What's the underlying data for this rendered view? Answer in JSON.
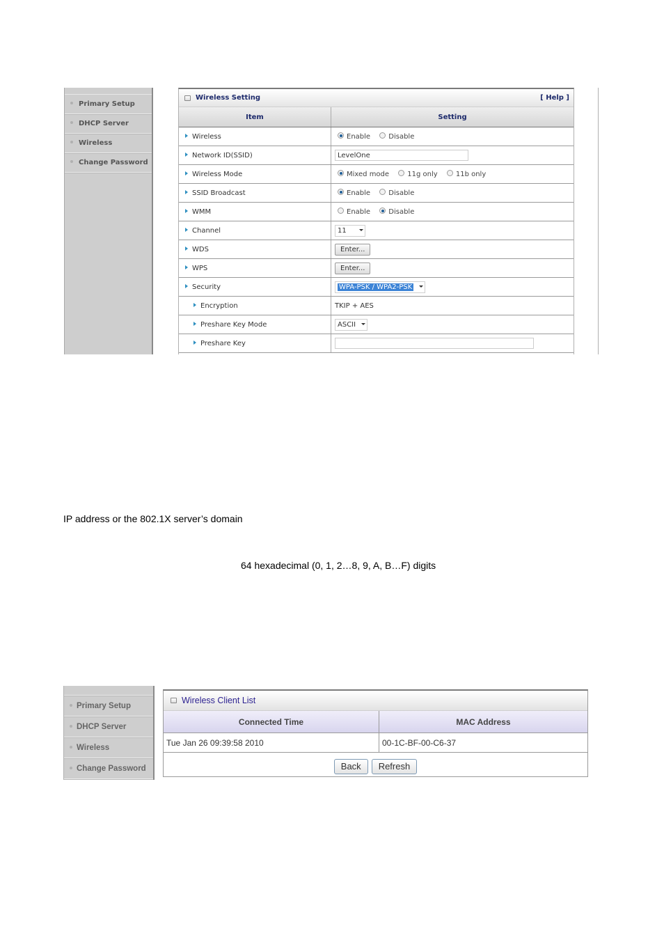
{
  "screenshot1": {
    "sidebar": {
      "items": [
        {
          "label": "Primary Setup"
        },
        {
          "label": "DHCP Server"
        },
        {
          "label": "Wireless"
        },
        {
          "label": "Change Password"
        }
      ]
    },
    "panel": {
      "title": "Wireless Setting",
      "help_link": "[ Help ]",
      "col_item": "Item",
      "col_setting": "Setting",
      "rows": {
        "wireless": {
          "label": "Wireless",
          "opt1": "Enable",
          "opt2": "Disable",
          "selected": "Enable"
        },
        "ssid": {
          "label": "Network ID(SSID)",
          "value": "LevelOne"
        },
        "mode": {
          "label": "Wireless Mode",
          "opt1": "Mixed mode",
          "opt2": "11g only",
          "opt3": "11b only",
          "selected": "Mixed mode"
        },
        "ssid_broadcast": {
          "label": "SSID Broadcast",
          "opt1": "Enable",
          "opt2": "Disable",
          "selected": "Enable"
        },
        "wmm": {
          "label": "WMM",
          "opt1": "Enable",
          "opt2": "Disable",
          "selected": "Disable"
        },
        "channel": {
          "label": "Channel",
          "value": "11"
        },
        "wds": {
          "label": "WDS",
          "button": "Enter..."
        },
        "wps": {
          "label": "WPS",
          "button": "Enter..."
        },
        "security": {
          "label": "Security",
          "value": "WPA-PSK / WPA2-PSK"
        },
        "encryption": {
          "label": "Encryption",
          "value": "TKIP + AES"
        },
        "key_mode": {
          "label": "Preshare Key Mode",
          "value": "ASCII"
        },
        "preshare_key": {
          "label": "Preshare Key",
          "value": ""
        }
      }
    }
  },
  "document": {
    "line1": "IP address or the 802.1X server’s domain",
    "line2": "64 hexadecimal (0, 1, 2…8, 9, A, B…F) digits"
  },
  "screenshot2": {
    "sidebar": {
      "items": [
        {
          "label": "Primary Setup"
        },
        {
          "label": "DHCP Server"
        },
        {
          "label": "Wireless"
        },
        {
          "label": "Change Password"
        }
      ]
    },
    "panel": {
      "title": "Wireless Client List",
      "columns": [
        "Connected Time",
        "MAC Address"
      ],
      "rows": [
        {
          "time": "Tue Jan 26 09:39:58 2010",
          "mac": "00-1C-BF-00-C6-37"
        }
      ],
      "back_label": "Back",
      "refresh_label": "Refresh"
    }
  }
}
